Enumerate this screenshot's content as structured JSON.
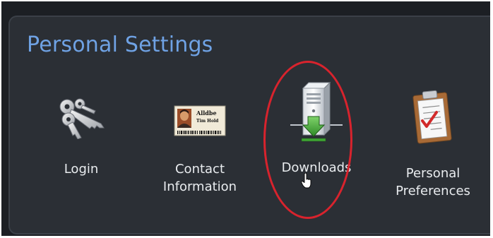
{
  "panel": {
    "title": "Personal Settings"
  },
  "items": [
    {
      "icon": "key-icon",
      "lines": [
        "Login"
      ]
    },
    {
      "icon": "id-card-icon",
      "lines": [
        "Contact",
        "Information"
      ]
    },
    {
      "icon": "download-server-icon",
      "lines": [
        "Downloads"
      ]
    },
    {
      "icon": "clipboard-checklist-icon",
      "lines": [
        "Personal",
        "Preferences"
      ]
    }
  ],
  "id_card": {
    "title": "Alldbe",
    "line": "Tim Hold"
  },
  "colors": {
    "title": "#6fa2e4",
    "panel_bg": "#2b2f35",
    "frame_bg": "#1c1f24",
    "highlight": "#d8232d"
  }
}
